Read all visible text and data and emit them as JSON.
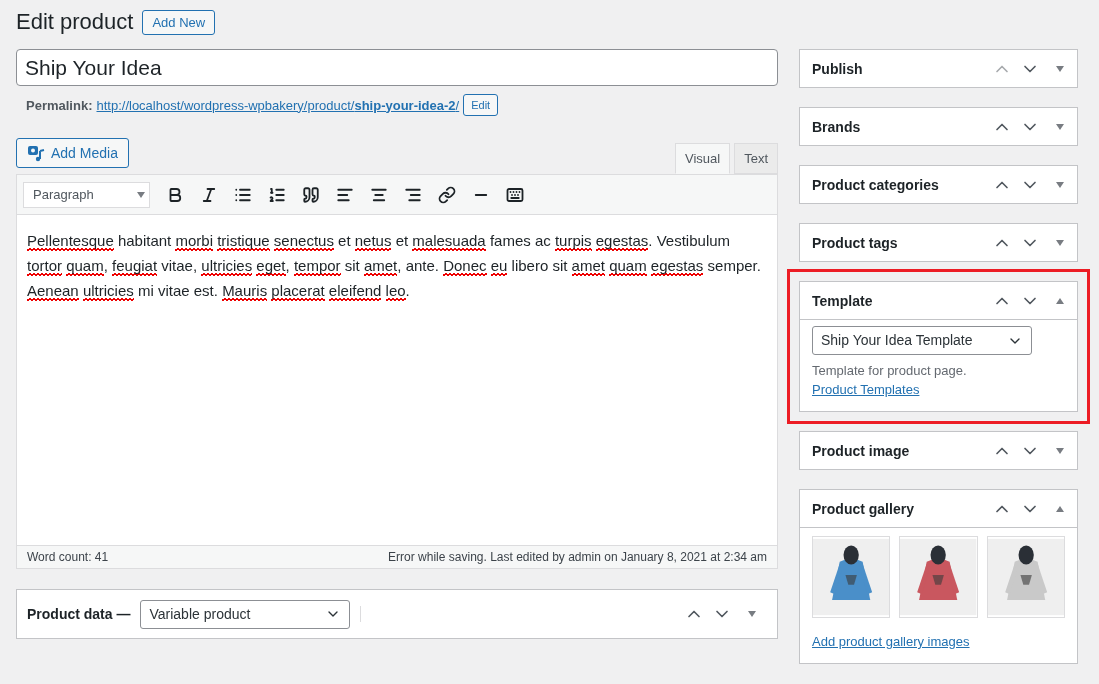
{
  "heading": {
    "title": "Edit product",
    "add_new": "Add New"
  },
  "post_title": {
    "value": "Ship Your Idea"
  },
  "permalink": {
    "label": "Permalink:",
    "url": "http://localhost/wordpress-wpbakery/product/",
    "slug": "ship-your-idea-2",
    "trail": "/",
    "edit": "Edit"
  },
  "add_media": "Add Media",
  "editor_tabs": [
    {
      "label": "Visual",
      "selected": true
    },
    {
      "label": "Text",
      "selected": false
    }
  ],
  "format_select": {
    "value": "Paragraph"
  },
  "content": [
    {
      "text": "Pellentesque",
      "misspelled": true
    },
    {
      "text": "habitant",
      "misspelled": false
    },
    {
      "text": "morbi",
      "misspelled": true
    },
    {
      "text": "tristique",
      "misspelled": true
    },
    {
      "text": "senectus",
      "misspelled": true
    },
    {
      "text": "et",
      "misspelled": false
    },
    {
      "text": "netus",
      "misspelled": true
    },
    {
      "text": "et",
      "misspelled": false
    },
    {
      "text": "malesuada",
      "misspelled": true
    },
    {
      "text": "fames ac",
      "misspelled": false
    },
    {
      "text": "turpis",
      "misspelled": true
    },
    {
      "text": "egestas",
      "misspelled": true,
      "after": "."
    },
    {
      "text": "Vestibulum",
      "misspelled": false
    },
    {
      "text": "tortor",
      "misspelled": true
    },
    {
      "text": "quam",
      "misspelled": true,
      "after": ","
    },
    {
      "text": "feugiat",
      "misspelled": true
    },
    {
      "text": "vitae,",
      "misspelled": false
    },
    {
      "text": "ultricies",
      "misspelled": true
    },
    {
      "text": "eget",
      "misspelled": true,
      "after": ","
    },
    {
      "text": "tempor",
      "misspelled": true
    },
    {
      "text": "sit",
      "misspelled": false
    },
    {
      "text": "amet",
      "misspelled": true,
      "after": ","
    },
    {
      "text": "ante.",
      "misspelled": false
    },
    {
      "text": "Donec",
      "misspelled": true
    },
    {
      "text": "eu",
      "misspelled": true
    },
    {
      "text": "libero sit",
      "misspelled": false
    },
    {
      "text": "amet",
      "misspelled": true
    },
    {
      "text": "quam",
      "misspelled": true
    },
    {
      "text": "egestas",
      "misspelled": true
    },
    {
      "text": "semper.",
      "misspelled": false
    },
    {
      "text": "Aenean",
      "misspelled": true
    },
    {
      "text": "ultricies",
      "misspelled": true
    },
    {
      "text": "mi vitae est.",
      "misspelled": false
    },
    {
      "text": "Mauris",
      "misspelled": true
    },
    {
      "text": "placerat",
      "misspelled": true
    },
    {
      "text": "eleifend",
      "misspelled": true
    },
    {
      "text": "leo",
      "misspelled": true,
      "after": "."
    }
  ],
  "status_bar": {
    "word_count": "Word count: 41",
    "last_edited": "Error while saving. Last edited by admin on January 8, 2021 at 2:34 am"
  },
  "product_data": {
    "title": "Product data —",
    "type_select": "Variable product",
    "expanded": false,
    "up_disabled": false
  },
  "sidebar": [
    {
      "kind": "plain",
      "title": "Publish",
      "expanded": false,
      "up_disabled": true,
      "highlighted": false
    },
    {
      "kind": "plain",
      "title": "Brands",
      "expanded": false,
      "up_disabled": false,
      "highlighted": false
    },
    {
      "kind": "plain",
      "title": "Product categories",
      "expanded": false,
      "up_disabled": false,
      "highlighted": false
    },
    {
      "kind": "plain",
      "title": "Product tags",
      "expanded": false,
      "up_disabled": false,
      "highlighted": false
    },
    {
      "kind": "template",
      "title": "Template",
      "expanded": true,
      "up_disabled": false,
      "highlighted": true,
      "select": "Ship Your Idea Template",
      "description": "Template for product page.",
      "link": "Product Templates"
    },
    {
      "kind": "plain",
      "title": "Product image",
      "expanded": false,
      "up_disabled": false,
      "highlighted": false
    },
    {
      "kind": "gallery",
      "title": "Product gallery",
      "expanded": true,
      "up_disabled": false,
      "highlighted": false,
      "link": "Add product gallery images"
    }
  ]
}
